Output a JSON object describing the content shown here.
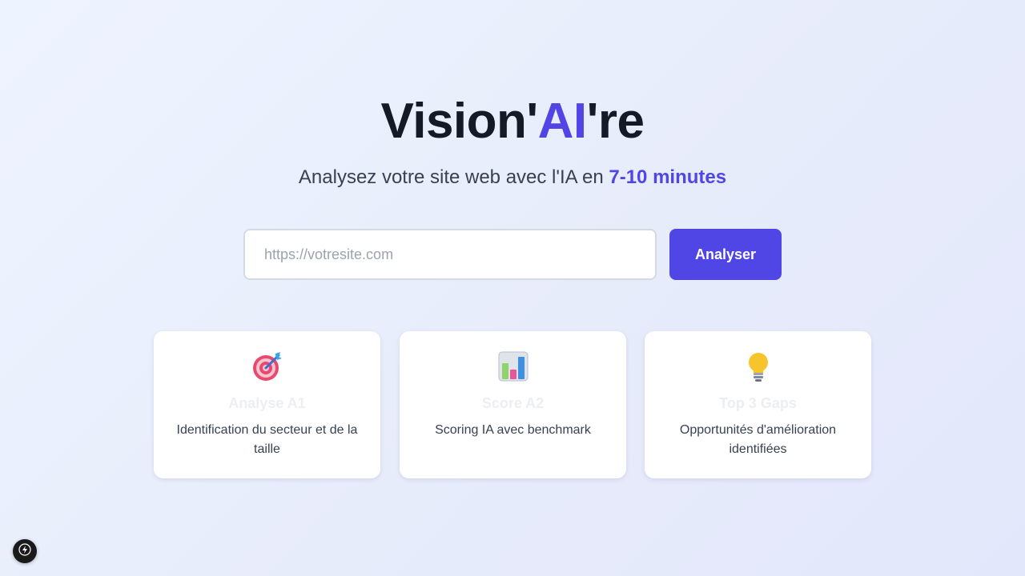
{
  "hero": {
    "title_prefix": "Vision'",
    "title_accent": "AI",
    "title_suffix": "'re",
    "subtitle_text": "Analysez votre site web avec l'IA en ",
    "subtitle_highlight": "7-10 minutes"
  },
  "search": {
    "placeholder": "https://votresite.com",
    "value": "",
    "button_label": "Analyser"
  },
  "features": [
    {
      "icon": "target-icon",
      "title": "Analyse A1",
      "description": "Identification du secteur et de la taille"
    },
    {
      "icon": "bar-chart-icon",
      "title": "Score A2",
      "description": "Scoring IA avec benchmark"
    },
    {
      "icon": "lightbulb-icon",
      "title": "Top 3 Gaps",
      "description": "Opportunités d'amélioration identifiées"
    }
  ],
  "colors": {
    "accent": "#4f46e5",
    "title_dark": "#141a26",
    "background_start": "#eef4ff",
    "background_end": "#e3e7fb"
  },
  "dev_indicator": {
    "icon": "lightning-bolt-icon"
  }
}
